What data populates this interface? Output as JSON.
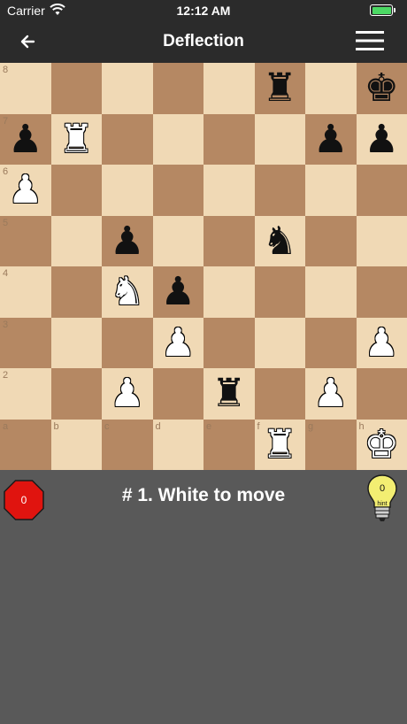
{
  "status": {
    "carrier": "Carrier",
    "time": "12:12 AM"
  },
  "nav": {
    "title": "Deflection"
  },
  "board": {
    "ranks": [
      "8",
      "7",
      "6",
      "5",
      "4",
      "3",
      "2",
      "1"
    ],
    "files": [
      "a",
      "b",
      "c",
      "d",
      "e",
      "f",
      "g",
      "h"
    ],
    "pieces": [
      {
        "square": "f8",
        "color": "b",
        "type": "rook"
      },
      {
        "square": "h8",
        "color": "b",
        "type": "king"
      },
      {
        "square": "a7",
        "color": "b",
        "type": "pawn"
      },
      {
        "square": "b7",
        "color": "w",
        "type": "rook"
      },
      {
        "square": "g7",
        "color": "b",
        "type": "pawn"
      },
      {
        "square": "h7",
        "color": "b",
        "type": "pawn"
      },
      {
        "square": "a6",
        "color": "w",
        "type": "pawn"
      },
      {
        "square": "c5",
        "color": "b",
        "type": "pawn"
      },
      {
        "square": "f5",
        "color": "b",
        "type": "knight"
      },
      {
        "square": "c4",
        "color": "w",
        "type": "knight"
      },
      {
        "square": "d4",
        "color": "b",
        "type": "pawn"
      },
      {
        "square": "d3",
        "color": "w",
        "type": "pawn"
      },
      {
        "square": "h3",
        "color": "w",
        "type": "pawn"
      },
      {
        "square": "c2",
        "color": "w",
        "type": "pawn"
      },
      {
        "square": "e2",
        "color": "b",
        "type": "rook"
      },
      {
        "square": "g2",
        "color": "w",
        "type": "pawn"
      },
      {
        "square": "f1",
        "color": "w",
        "type": "rook"
      },
      {
        "square": "h1",
        "color": "w",
        "type": "king"
      }
    ]
  },
  "puzzle": {
    "prompt": "# 1. White to move",
    "mistakes": "0",
    "hints": "0",
    "hint_label": "hint"
  },
  "colors": {
    "light_square": "#f0d9b5",
    "dark_square": "#b58863",
    "stop": "#e0140f",
    "hint_bulb": "#f3ee72"
  }
}
